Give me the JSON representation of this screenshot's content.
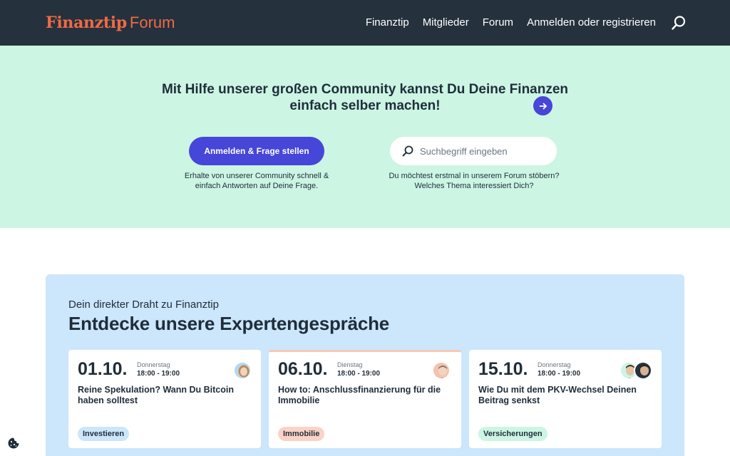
{
  "header": {
    "brand": "Finanztip",
    "brand_sub": "Forum",
    "nav": [
      "Finanztip",
      "Mitglieder",
      "Forum",
      "Anmelden oder registrieren"
    ],
    "search_icon": "search-icon",
    "bg_color": "#25313c",
    "brand_color": "#ef6a45"
  },
  "hero": {
    "headline": "Mit Hilfe unserer großen Community kannst Du Deine Finanzen einfach selber machen!",
    "cta_label": "Anmelden & Frage stellen",
    "cta_desc": "Erhalte von unserer Community schnell & einfach Antworten auf Deine Frage.",
    "search_placeholder": "Suchbegriff eingeben",
    "search_desc": "Du möchtest erstmal in unserem Forum stöbern? Welches Thema interessiert Dich?",
    "bg_color": "#ccf5e4",
    "accent_color": "#4646d8"
  },
  "experts": {
    "kicker": "Dein direkter Draht zu Finanztip",
    "title": "Entdecke unsere Expertengespräche",
    "bg_color": "#cce6fb",
    "cards": [
      {
        "date": "01.10.",
        "day": "Donnerstag",
        "time": "18:00 - 19:00",
        "title": "Reine Spekulation? Wann Du Bitcoin haben solltest",
        "tag": "Investieren",
        "tag_color": "#cce6fb"
      },
      {
        "date": "06.10.",
        "day": "Dienstag",
        "time": "18:00 - 19:00",
        "title": "How to: Anschlussfinanzierung für die Immobilie",
        "tag": "Immobilie",
        "tag_color": "#fbd3c6"
      },
      {
        "date": "15.10.",
        "day": "Donnerstag",
        "time": "18:00 - 19:00",
        "title": "Wie Du mit dem PKV-Wechsel Deinen Beitrag senkst",
        "tag": "Versicherungen",
        "tag_color": "#ccf5e4"
      }
    ]
  },
  "cookie_icon": "cookie-icon"
}
